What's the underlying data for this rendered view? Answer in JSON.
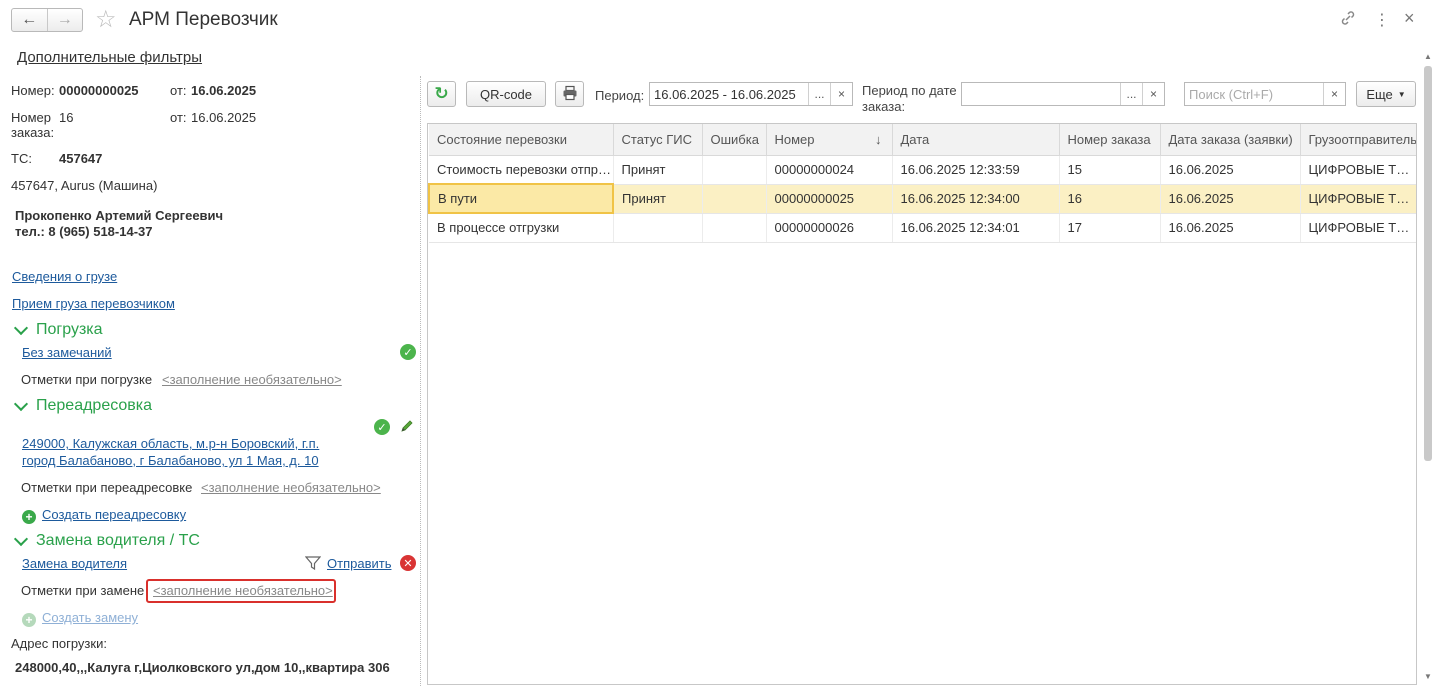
{
  "window": {
    "title": "АРМ Перевозчик",
    "back_icon": "←",
    "forward_icon": "→",
    "star_icon": "☆",
    "link_icon": "🔗",
    "more_icon": "⋮",
    "close_icon": "×"
  },
  "filters_link": "Дополнительные фильтры",
  "details": {
    "number_label": "Номер:",
    "number_value": "00000000025",
    "from_label": "от:",
    "from_value": "16.06.2025",
    "order_label_1": "Номер",
    "order_label_2": "заказа:",
    "order_value": "16",
    "order_from_label": "от:",
    "order_from_value": "16.06.2025",
    "ts_label": "ТС:",
    "ts_value": "457647",
    "vehicle": "457647, Aurus (Машина)",
    "driver_name": "Прокопенко Артемий Сергеевич",
    "driver_phone": "тел.: 8 (965) 518-14-37",
    "cargo_info_link": "Сведения о грузе",
    "cargo_accept_link": "Прием груза перевозчиком"
  },
  "loading": {
    "title": "Погрузка",
    "status_link": "Без замечаний",
    "notes_label": "Отметки при погрузке",
    "notes_hint": "<заполнение необязательно>"
  },
  "redirect": {
    "title": "Переадресовка",
    "address_line1": "249000, Калужская область, м.р-н Боровский, г.п.",
    "address_line2": "город Балабаново, г Балабаново, ул 1 Мая, д. 10",
    "notes_label": "Отметки при переадресовке",
    "notes_hint": "<заполнение необязательно>",
    "create_link": "Создать переадресовку"
  },
  "replace": {
    "title": "Замена водителя / ТС",
    "driver_link": "Замена водителя",
    "send_link": "Отправить",
    "notes_label": "Отметки при замене",
    "notes_hint": "<заполнение необязательно>",
    "create_link": "Создать замену"
  },
  "loading_address": {
    "label": "Адрес погрузки:",
    "value": "248000,40,,,Калуга г,Циолковского ул,дом 10,,квартира 306"
  },
  "toolbar": {
    "refresh_icon": "↻",
    "qr_label": "QR-code",
    "print_icon": "🖶",
    "period_label": "Период:",
    "period_value": "16.06.2025 - 16.06.2025",
    "period_by_order_label_1": "Период по дате",
    "period_by_order_label_2": "заказа:",
    "period_by_order_value": "",
    "search_placeholder": "Поиск (Ctrl+F)",
    "more_label": "Еще"
  },
  "table": {
    "columns": [
      "Состояние перевозки",
      "Статус ГИС",
      "Ошибка",
      "Номер",
      "Дата",
      "Номер заказа",
      "Дата заказа (заявки)",
      "Грузоотправитель"
    ],
    "rows": [
      [
        "Стоимость перевозки отправлена",
        "Принят",
        "",
        "00000000024",
        "16.06.2025 12:33:59",
        "15",
        "16.06.2025",
        "ЦИФРОВЫЕ ТЕХНОЛОГИИ"
      ],
      [
        "В пути",
        "Принят",
        "",
        "00000000025",
        "16.06.2025 12:34:00",
        "16",
        "16.06.2025",
        "ЦИФРОВЫЕ ТЕХНОЛОГИИ"
      ],
      [
        "В процессе отгрузки",
        "",
        "",
        "00000000026",
        "16.06.2025 12:34:01",
        "17",
        "16.06.2025",
        "ЦИФРОВЫЕ ТЕХНОЛОГИИ"
      ]
    ],
    "selected_row": 1
  }
}
